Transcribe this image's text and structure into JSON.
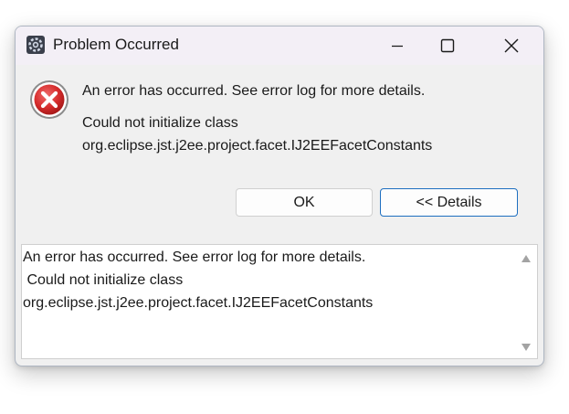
{
  "window": {
    "title": "Problem Occurred",
    "app_icon": "eclipse-gear-icon"
  },
  "titlebar_buttons": {
    "minimize_icon": "minimize-icon",
    "maximize_icon": "maximize-icon",
    "close_icon": "close-icon"
  },
  "message": {
    "icon": "error-icon",
    "icon_color": "#d52b2b",
    "line1": "An error has occurred. See error log for more details.",
    "line2": "Could not initialize class",
    "line3": "org.eclipse.jst.j2ee.project.facet.IJ2EEFacetConstants"
  },
  "buttons": {
    "ok_label": "OK",
    "details_label": "<< Details"
  },
  "details": {
    "line1": "An error has occurred. See error log for more details.",
    "line2": " Could not initialize class",
    "line3": "org.eclipse.jst.j2ee.project.facet.IJ2EEFacetConstants"
  },
  "colors": {
    "accent_border": "#1e6fc0",
    "dialog_bg": "#f0f0f0",
    "titlebar_bg": "#f3eff6"
  }
}
